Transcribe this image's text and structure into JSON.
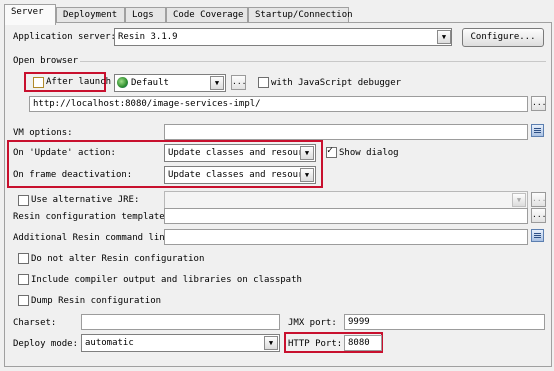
{
  "tabs": [
    "Server",
    "Deployment",
    "Logs",
    "Code Coverage",
    "Startup/Connection"
  ],
  "app_server": {
    "label": "Application server:",
    "value": "Resin 3.1.9",
    "configure_button": "Configure..."
  },
  "open_browser": {
    "section_label": "Open browser",
    "after_launch_label": "After launch",
    "after_launch_checked": false,
    "browser_value": "Default",
    "browse_button": "...",
    "js_debugger_label": "with JavaScript debugger",
    "js_debugger_checked": false,
    "url": "http://localhost:8080/image-services-impl/",
    "url_button": "..."
  },
  "vm_options": {
    "label": "VM options:",
    "value": ""
  },
  "update_action": {
    "label": "On 'Update' action:",
    "value": "Update classes and resources"
  },
  "show_dialog": {
    "label": "Show dialog",
    "checked": true
  },
  "frame_deactivation": {
    "label": "On frame deactivation:",
    "value": "Update classes and resources"
  },
  "alt_jre": {
    "label": "Use alternative JRE:",
    "checked": false,
    "value": "",
    "button": "..."
  },
  "resin_config_template": {
    "label": "Resin configuration template:",
    "value": "",
    "button": "..."
  },
  "additional_cmd": {
    "label": "Additional Resin command line:",
    "value": ""
  },
  "options": [
    {
      "label": "Do not alter Resin configuration",
      "checked": false
    },
    {
      "label": "Include compiler output and libraries on classpath",
      "checked": false
    },
    {
      "label": "Dump Resin configuration",
      "checked": false
    }
  ],
  "charset": {
    "label": "Charset:",
    "value": ""
  },
  "jmx_port": {
    "label": "JMX port:",
    "value": "9999"
  },
  "deploy_mode": {
    "label": "Deploy mode:",
    "value": "automatic"
  },
  "http_port": {
    "label": "HTTP Port:",
    "value": "8080"
  },
  "colors": {
    "highlight": "#c8102e",
    "panel_bg": "#f0f0f0",
    "icon_blue": "#5c7fb0"
  }
}
